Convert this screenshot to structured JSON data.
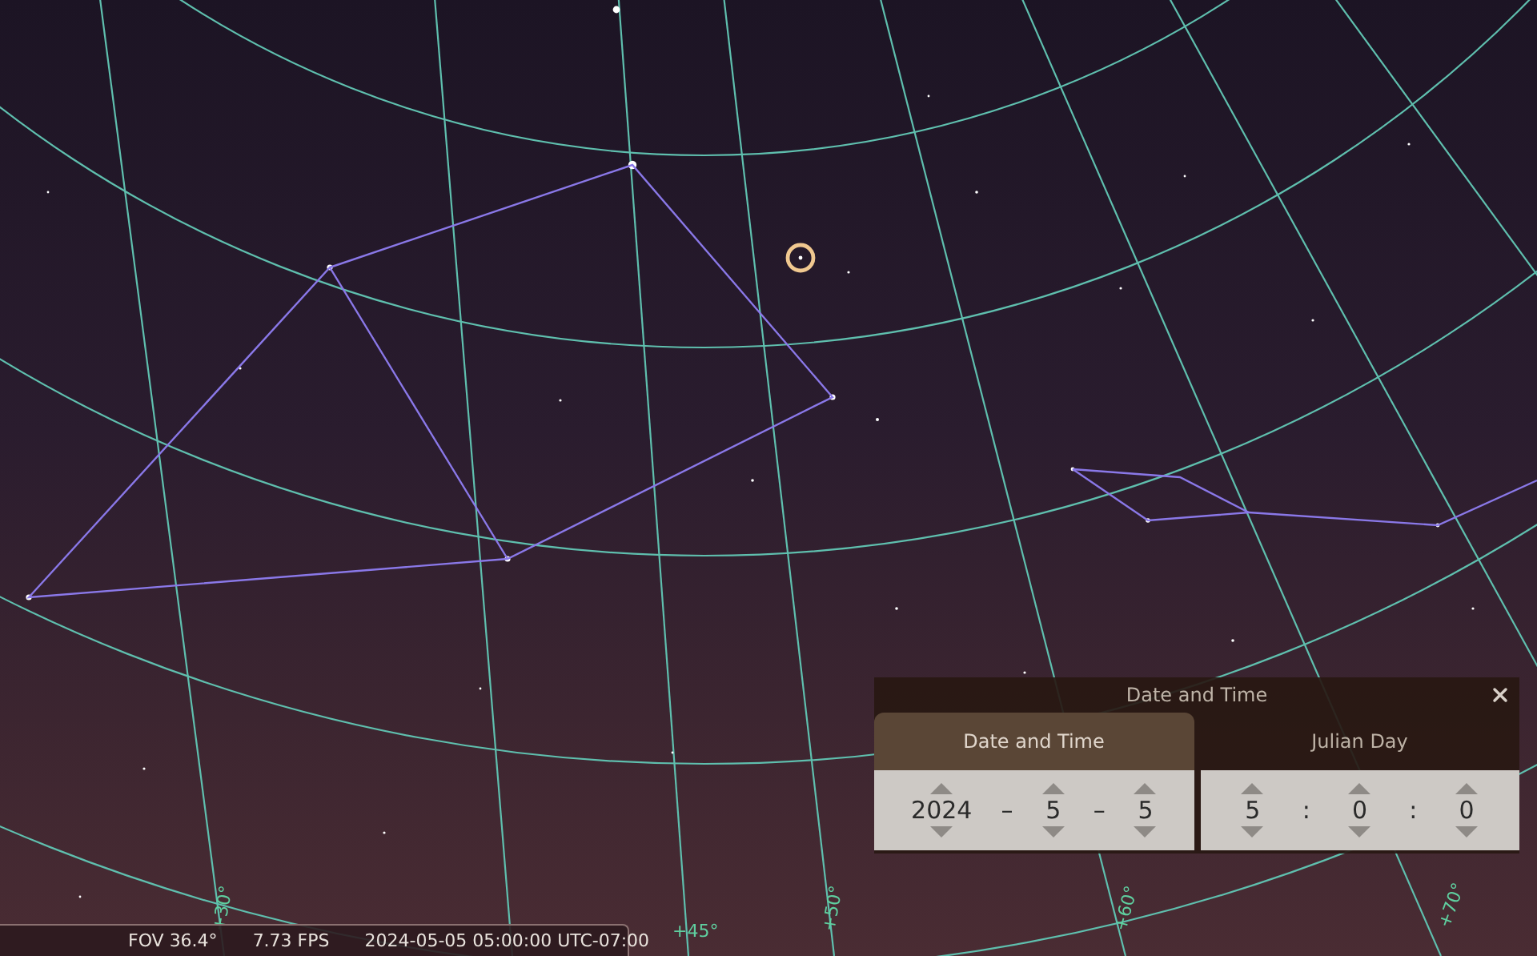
{
  "sky": {
    "grid_labels": [
      {
        "text": "+30°"
      },
      {
        "text": "+45°"
      },
      {
        "text": "+50°"
      },
      {
        "text": "+60°"
      },
      {
        "text": "+70°"
      }
    ]
  },
  "dialog": {
    "title": "Date and Time",
    "tabs": [
      {
        "label": "Date and Time",
        "selected": true
      },
      {
        "label": "Julian Day",
        "selected": false
      }
    ],
    "panels": [
      {
        "items": [
          {
            "kind": "spinner",
            "value": "2024"
          },
          {
            "kind": "separator",
            "text": "–"
          },
          {
            "kind": "spinner",
            "value": "5"
          },
          {
            "kind": "separator",
            "text": "–"
          },
          {
            "kind": "spinner",
            "value": "5"
          }
        ]
      },
      {
        "items": [
          {
            "kind": "spinner",
            "value": "5"
          },
          {
            "kind": "separator",
            "text": ":"
          },
          {
            "kind": "spinner",
            "value": "0"
          },
          {
            "kind": "separator",
            "text": ":"
          },
          {
            "kind": "spinner",
            "value": "0"
          }
        ]
      }
    ]
  },
  "status_bar": {
    "fov": "FOV 36.4°",
    "fps": "7.73 FPS",
    "datetime": "2024-05-05 05:00:00 UTC-07:00"
  }
}
